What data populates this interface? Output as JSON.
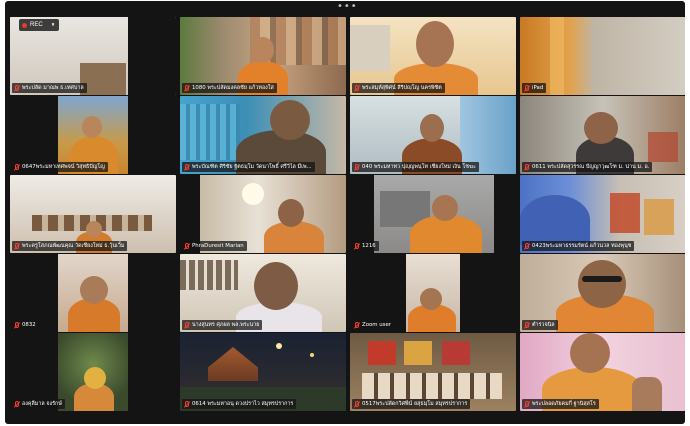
{
  "window": {
    "more_glyph": "•••",
    "recording": {
      "label": "REC",
      "control_glyph": "⏸"
    }
  },
  "tiles": [
    {
      "name": "พระปลัด มาณพ ธ.เทศบาล",
      "bg": "#dcd6cf"
    },
    {
      "name": "1080 พระปลัดมงคลชัย แก้วทองใส",
      "bg": "#8b7a63"
    },
    {
      "name": "พระสมุห์สุพิศน์ สิริปญฺโญ นครพิชิต",
      "bg": "#f0d8a6"
    },
    {
      "name": "iPad",
      "bg": "#d08a2e"
    },
    {
      "name": "0647พระมหาเทศพจน์ วิสุทธิปัญโญ",
      "bg": "#8fa8c0"
    },
    {
      "name": "พระบัณฑิต ศิริชัย ฐิตธมฺโม วัดนาโพธิ์ ศรีวิไล มีเพ...",
      "bg": "#4fa6c8"
    },
    {
      "name": "040 พระมหาทว ปุญฺญพนฺโท เชียงใหม่ เงิน โชฆะ",
      "bg": "#c7d4d8"
    },
    {
      "name": "0611 พระปลัดสุวรรณ ปัญญาวุฒโฑ ม. น่าน ม. อ.",
      "bg": "#b9b6ad"
    },
    {
      "name": "พระครูโสภณพัฒนคุณ วัดเชียงใหม่ ธ.วุ้นเวิ้ม",
      "bg": "#e2ddd3"
    },
    {
      "name": "PhraDuresit Marian",
      "bg": "#c4b9a8"
    },
    {
      "name": "1216",
      "bg": "#9a9b9c"
    },
    {
      "name": "0423พระมหาธรรมรัตน์ แก้วนวล ทองพุนุช",
      "bg": "#b6b3bc"
    },
    {
      "name": "0832",
      "bg": "#d9c6b8"
    },
    {
      "name": "นางสุนทร ศุภผล พล.พระนาย",
      "bg": "#c9c2b5"
    },
    {
      "name": "Zoom user",
      "bg": "#cfc7c0"
    },
    {
      "name": "ตำรวจนิล",
      "bg": "#b9aa98"
    },
    {
      "name": "องคุลีมาล จงรักษ์",
      "bg": "#4b5a3d"
    },
    {
      "name": "0614 พระมหาอนุ ดวงปราไว สมุทรปราการ",
      "bg": "#1f2a3a"
    },
    {
      "name": "0517พระปลัดกวิศพีน์ ยสุธมฺโม สมุทรปราการ",
      "bg": "#8a6d4c"
    },
    {
      "name": "พระปลอดภัยคมกี่ ฐานิสฺสโร",
      "bg": "#e8c7d6"
    }
  ]
}
